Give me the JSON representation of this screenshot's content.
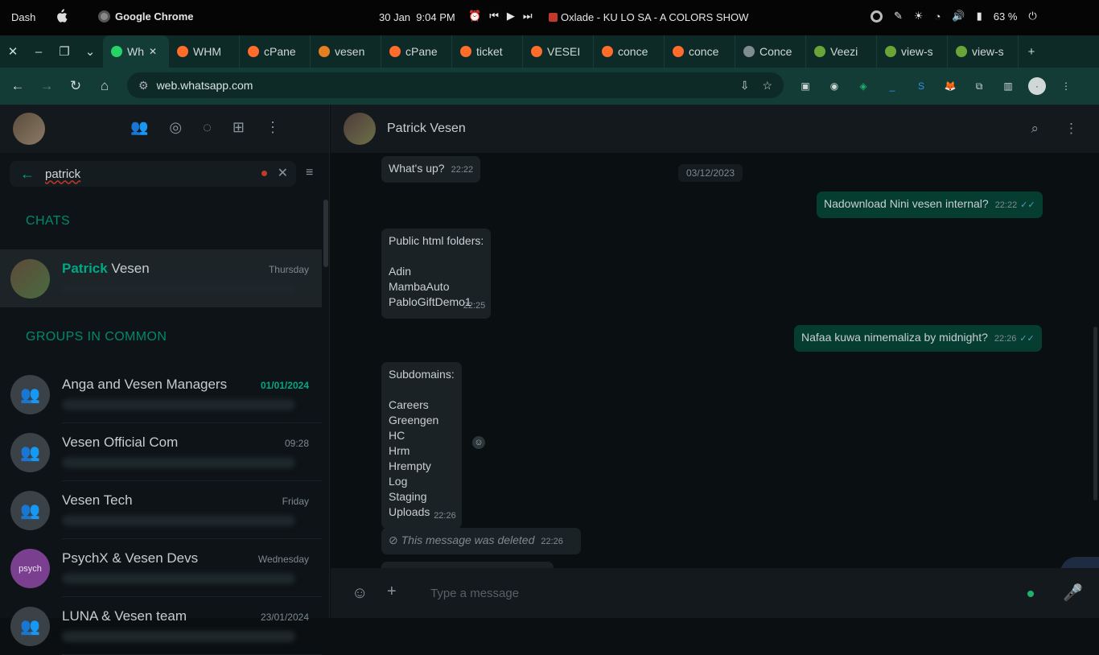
{
  "topbar": {
    "dash": "Dash",
    "app_name": "Google Chrome",
    "date": "30 Jan",
    "time": "9:04 PM",
    "track": "Oxlade - KU LO SA - A COLORS SHOW",
    "battery": "63 %"
  },
  "tabs": [
    {
      "label": "Wh",
      "icon": "whatsapp-icon",
      "color": "#25d366",
      "active": true
    },
    {
      "label": "WHM",
      "icon": "cpanel-icon",
      "color": "#ff6c2c"
    },
    {
      "label": "cPane",
      "icon": "cpanel-icon",
      "color": "#ff6c2c"
    },
    {
      "label": "vesen",
      "icon": "vesen-icon",
      "color": "#e67e22"
    },
    {
      "label": "cPane",
      "icon": "cpanel-icon",
      "color": "#ff6c2c"
    },
    {
      "label": "ticket",
      "icon": "cpanel-icon",
      "color": "#ff6c2c"
    },
    {
      "label": "VESEI",
      "icon": "cpanel-icon",
      "color": "#ff6c2c"
    },
    {
      "label": "conce",
      "icon": "cpanel-icon",
      "color": "#ff6c2c"
    },
    {
      "label": "conce",
      "icon": "cpanel-icon",
      "color": "#ff6c2c"
    },
    {
      "label": "Conce",
      "icon": "globe-icon",
      "color": "#7f8c91"
    },
    {
      "label": "Veezi",
      "icon": "vue-icon",
      "color": "#6ba539"
    },
    {
      "label": "view-s",
      "icon": "vue-icon",
      "color": "#6ba539"
    },
    {
      "label": "view-s",
      "icon": "vue-icon",
      "color": "#6ba539"
    }
  ],
  "address": {
    "url": "web.whatsapp.com"
  },
  "search": {
    "value": "patrick"
  },
  "sections": {
    "chats": "CHATS",
    "groups": "GROUPS IN COMMON"
  },
  "contact_row": {
    "name_highlight": "Patrick",
    "name_rest": " Vesen",
    "time": "Thursday"
  },
  "groups": [
    {
      "name": "Anga and Vesen Managers",
      "time": "01/01/2024",
      "unread": true
    },
    {
      "name": "Vesen Official Com",
      "time": "09:28"
    },
    {
      "name": "Vesen Tech",
      "time": "Friday"
    },
    {
      "name": "PsychX & Vesen Devs",
      "time": "Wednesday",
      "avatar_text": "psych"
    },
    {
      "name": "LUNA & Vesen team",
      "time": "23/01/2024"
    }
  ],
  "conversation": {
    "name": "Patrick Vesen",
    "date_pill": "03/12/2023",
    "messages": {
      "m1": {
        "text": "What's up?",
        "time": "22:22"
      },
      "m2": {
        "text": "Nadownload Nini vesen internal?",
        "time": "22:22"
      },
      "m3": {
        "lines": [
          "Public html folders:",
          "",
          "Adin",
          "MambaAuto",
          "PabloGiftDemo1"
        ],
        "time": "22:25"
      },
      "m4": {
        "text": "Nafaa kuwa nimemaliza by midnight?",
        "time": "22:26"
      },
      "m5": {
        "lines": [
          "Subdomains:",
          "",
          "Careers",
          "Greengen",
          "HC",
          "Hrm",
          "Hrempty",
          "Log",
          "Staging",
          "Uploads"
        ],
        "time": "22:26"
      },
      "m6": {
        "text": "This message was deleted",
        "time": "22:26"
      }
    },
    "composer_placeholder": "Type a message"
  },
  "colors": {
    "accent": "#00a884",
    "outgoing": "#053d31",
    "incoming": "#1a2226"
  }
}
